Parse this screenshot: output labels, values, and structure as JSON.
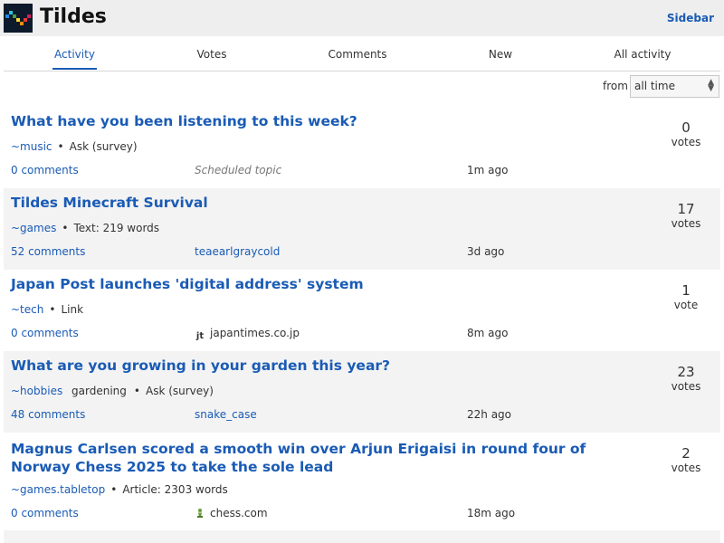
{
  "header": {
    "site_title": "Tildes",
    "sidebar_label": "Sidebar"
  },
  "tabs": [
    {
      "label": "Activity",
      "active": true
    },
    {
      "label": "Votes",
      "active": false
    },
    {
      "label": "Comments",
      "active": false
    },
    {
      "label": "New",
      "active": false
    },
    {
      "label": "All activity",
      "active": false
    }
  ],
  "period": {
    "label": "from",
    "selected": "all time"
  },
  "topics": [
    {
      "title": "What have you been listening to this week?",
      "group": "~music",
      "tags": "",
      "type": "Ask (survey)",
      "comments": "0 comments",
      "source": "Scheduled topic",
      "time": "1m ago",
      "vote_count": "0",
      "vote_label": "votes"
    },
    {
      "title": "Tildes Minecraft Survival",
      "group": "~games",
      "tags": "",
      "type": "Text: 219 words",
      "comments": "52 comments",
      "source": "teaearlgraycold",
      "time": "3d ago",
      "vote_count": "17",
      "vote_label": "votes"
    },
    {
      "title": "Japan Post launches 'digital address' system",
      "group": "~tech",
      "tags": "",
      "type": "Link",
      "comments": "0 comments",
      "source": "japantimes.co.jp",
      "favicon_text": "jt",
      "time": "8m ago",
      "vote_count": "1",
      "vote_label": "vote"
    },
    {
      "title": "What are you growing in your garden this year?",
      "group": "~hobbies",
      "tags": "gardening",
      "type": "Ask (survey)",
      "comments": "48 comments",
      "source": "snake_case",
      "time": "22h ago",
      "vote_count": "23",
      "vote_label": "votes"
    },
    {
      "title": "Magnus Carlsen scored a smooth win over Arjun Erigaisi in round four of Norway Chess 2025 to take the sole lead",
      "group": "~games.tabletop",
      "tags": "",
      "type": "Article: 2303 words",
      "comments": "0 comments",
      "source": "chess.com",
      "time": "18m ago",
      "vote_count": "2",
      "vote_label": "votes"
    }
  ],
  "colors": {
    "link": "#1a5bb5",
    "header_bg": "#eeeeee",
    "row_shade": "#f3f3f3"
  }
}
